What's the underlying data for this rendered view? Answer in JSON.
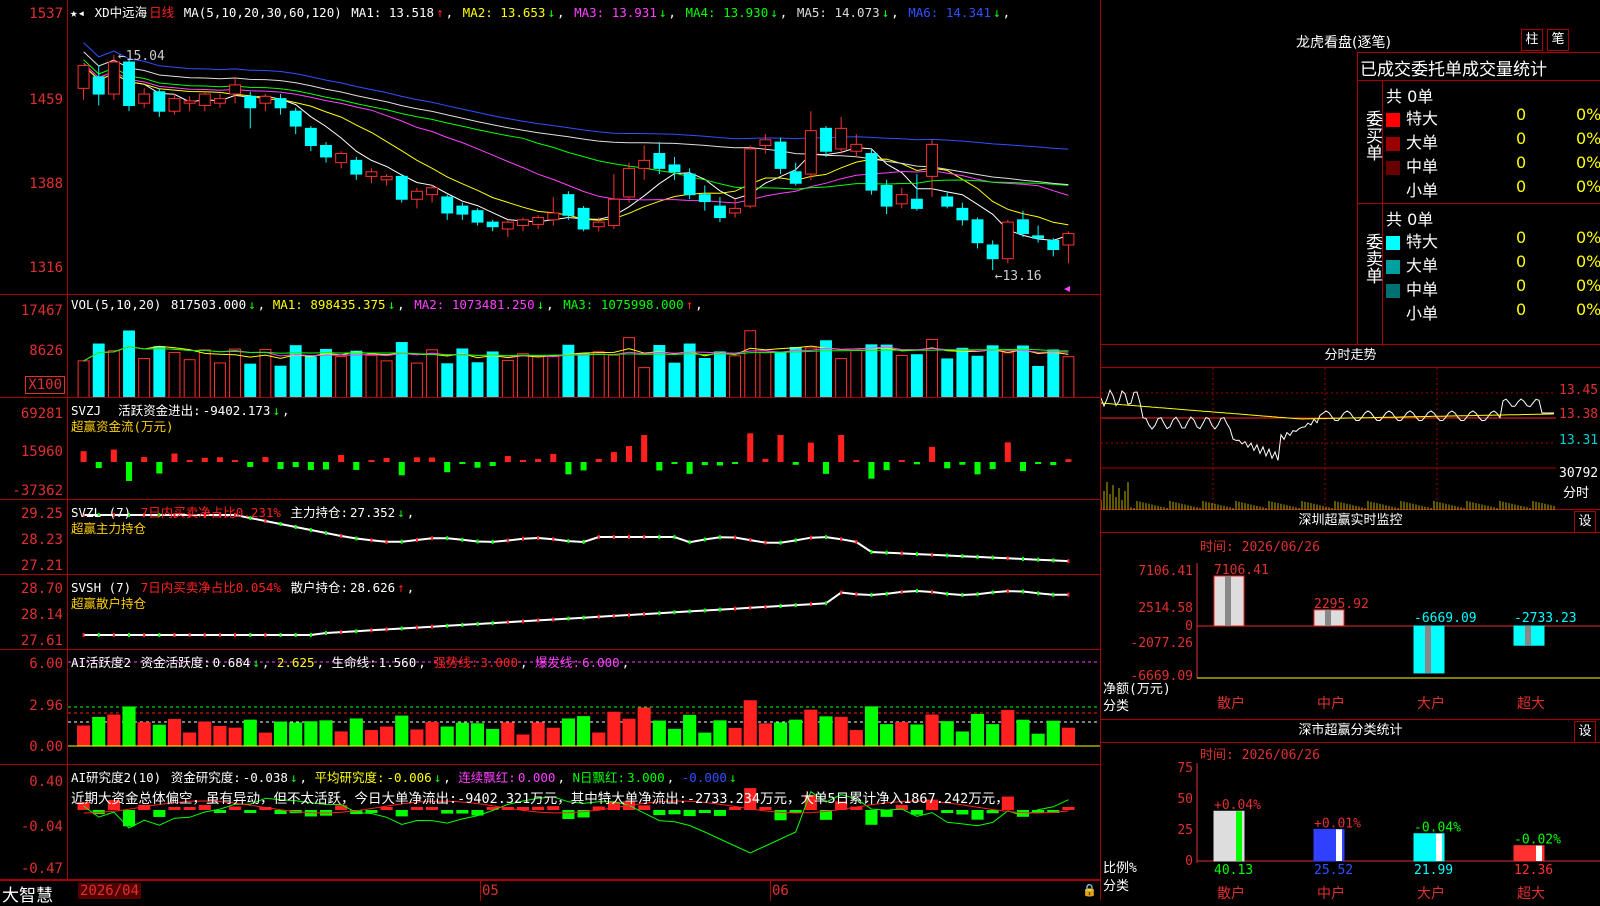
{
  "app": {
    "brand": "大智慧"
  },
  "kline": {
    "stock_name": "XD中远海",
    "period": "日线",
    "ma_params": "MA(5,10,20,30,60,120)",
    "ma_values": [
      {
        "label": "MA1:",
        "value": "13.518",
        "arrow": "↑",
        "color": "#ffffff"
      },
      {
        "label": "MA2:",
        "value": "13.653",
        "arrow": "↓",
        "color": "#ffff00"
      },
      {
        "label": "MA3:",
        "value": "13.931",
        "arrow": "↓",
        "color": "#ff40ff"
      },
      {
        "label": "MA4:",
        "value": "13.930",
        "arrow": "↓",
        "color": "#00ff00"
      },
      {
        "label": "MA5:",
        "value": "14.073",
        "arrow": "↓",
        "color": "#dddddd"
      },
      {
        "label": "MA6:",
        "value": "14.341",
        "arrow": "↓",
        "color": "#3050ff"
      }
    ],
    "y_ticks": [
      "1537",
      "1459",
      "1388",
      "1316"
    ],
    "high_label": "15.04",
    "low_label": "←13.16",
    "candles": [
      [
        14.75,
        14.95,
        14.65,
        14.85
      ],
      [
        14.85,
        14.7,
        14.6,
        14.95
      ],
      [
        14.7,
        14.98,
        14.65,
        15.04
      ],
      [
        14.98,
        14.6,
        14.55,
        15.0
      ],
      [
        14.62,
        14.7,
        14.58,
        14.75
      ],
      [
        14.72,
        14.55,
        14.5,
        14.75
      ],
      [
        14.55,
        14.66,
        14.52,
        14.7
      ],
      [
        14.62,
        14.64,
        14.55,
        14.68
      ],
      [
        14.6,
        14.7,
        14.55,
        14.72
      ],
      [
        14.62,
        14.66,
        14.58,
        14.7
      ],
      [
        14.7,
        14.78,
        14.62,
        14.85
      ],
      [
        14.68,
        14.58,
        14.4,
        14.72
      ],
      [
        14.62,
        14.68,
        14.55,
        14.7
      ],
      [
        14.66,
        14.58,
        14.52,
        14.7
      ],
      [
        14.55,
        14.42,
        14.35,
        14.58
      ],
      [
        14.4,
        14.25,
        14.2,
        14.42
      ],
      [
        14.25,
        14.15,
        14.1,
        14.28
      ],
      [
        14.1,
        14.18,
        14.05,
        14.2
      ],
      [
        14.12,
        14.0,
        13.95,
        14.15
      ],
      [
        13.98,
        14.02,
        13.92,
        14.05
      ],
      [
        13.95,
        13.98,
        13.9,
        14.0
      ],
      [
        13.98,
        13.78,
        13.75,
        14.0
      ],
      [
        13.78,
        13.85,
        13.7,
        13.88
      ],
      [
        13.82,
        13.88,
        13.75,
        13.9
      ],
      [
        13.8,
        13.66,
        13.6,
        13.82
      ],
      [
        13.72,
        13.65,
        13.6,
        13.75
      ],
      [
        13.68,
        13.58,
        13.55,
        13.7
      ],
      [
        13.58,
        13.54,
        13.5,
        13.6
      ],
      [
        13.52,
        13.58,
        13.45,
        13.6
      ],
      [
        13.55,
        13.6,
        13.5,
        13.62
      ],
      [
        13.56,
        13.62,
        13.52,
        13.64
      ],
      [
        13.6,
        13.66,
        13.55,
        13.8
      ],
      [
        13.82,
        13.64,
        13.6,
        13.85
      ],
      [
        13.7,
        13.52,
        13.5,
        13.72
      ],
      [
        13.54,
        13.58,
        13.5,
        13.62
      ],
      [
        13.55,
        13.78,
        13.52,
        14.0
      ],
      [
        13.8,
        14.05,
        13.75,
        14.1
      ],
      [
        14.05,
        14.12,
        13.95,
        14.25
      ],
      [
        14.18,
        14.05,
        14.0,
        14.28
      ],
      [
        14.08,
        14.02,
        13.95,
        14.15
      ],
      [
        14.0,
        13.82,
        13.78,
        14.05
      ],
      [
        13.82,
        13.76,
        13.68,
        13.9
      ],
      [
        13.72,
        13.62,
        13.58,
        13.8
      ],
      [
        13.66,
        13.7,
        13.62,
        13.78
      ],
      [
        13.72,
        14.22,
        13.7,
        14.25
      ],
      [
        14.25,
        14.3,
        14.18,
        14.35
      ],
      [
        14.28,
        14.05,
        14.0,
        14.32
      ],
      [
        14.02,
        13.92,
        13.9,
        14.1
      ],
      [
        14.0,
        14.38,
        13.95,
        14.55
      ],
      [
        14.4,
        14.2,
        14.15,
        14.42
      ],
      [
        14.22,
        14.4,
        14.18,
        14.5
      ],
      [
        14.2,
        14.26,
        14.15,
        14.35
      ],
      [
        14.18,
        13.86,
        13.82,
        14.22
      ],
      [
        13.9,
        13.72,
        13.65,
        13.95
      ],
      [
        13.74,
        13.82,
        13.7,
        13.88
      ],
      [
        13.78,
        13.7,
        13.68,
        14.0
      ],
      [
        13.98,
        14.26,
        13.8,
        14.3
      ],
      [
        13.8,
        13.72,
        13.7,
        13.85
      ],
      [
        13.7,
        13.6,
        13.55,
        13.75
      ],
      [
        13.6,
        13.4,
        13.35,
        13.62
      ],
      [
        13.38,
        13.26,
        13.16,
        13.42
      ],
      [
        13.26,
        13.58,
        13.22,
        13.6
      ],
      [
        13.6,
        13.48,
        13.45,
        13.68
      ],
      [
        13.46,
        13.44,
        13.4,
        13.55
      ],
      [
        13.42,
        13.34,
        13.28,
        13.44
      ],
      [
        13.38,
        13.48,
        13.22,
        13.5
      ]
    ]
  },
  "volume": {
    "title": "VOL(5,10,20)",
    "value": "817503.000",
    "arrow": "↓",
    "ma": [
      {
        "label": "MA1:",
        "value": "898435.375",
        "arrow": "↓",
        "color": "#ffff00"
      },
      {
        "label": "MA2:",
        "value": "1073481.250",
        "arrow": "↓",
        "color": "#ff40ff"
      },
      {
        "label": "MA3:",
        "value": "1075998.000",
        "arrow": "↑",
        "color": "#00ff00"
      }
    ],
    "y_ticks": [
      "17467",
      "8626"
    ],
    "unit_label": "X100"
  },
  "svzj": {
    "name": "SVZJ",
    "label": "活跃资金进出:",
    "value": "-9402.173",
    "arrow": "↓",
    "sub": "超赢资金流(万元)",
    "y_ticks": [
      "69281",
      "15960",
      "-37362"
    ]
  },
  "svzl": {
    "name": "SVZL (7)",
    "ratio": "7日内买卖净占比0.231%",
    "label": "主力持仓:",
    "value": "27.352",
    "arrow": "↓",
    "sub": "超赢主力持仓",
    "y_ticks": [
      "29.25",
      "28.23",
      "27.21"
    ]
  },
  "svsh": {
    "name": "SVSH (7)",
    "ratio": "7日内买卖净占比0.054%",
    "label": "散户持仓:",
    "value": "28.626",
    "arrow": "↑",
    "sub": "超赢散户持仓",
    "y_ticks": [
      "28.70",
      "28.14",
      "27.61"
    ]
  },
  "ai_active": {
    "name": "AI活跃度2",
    "label": "资金活跃度:",
    "value": "0.684",
    "arrow": "↓",
    "v2": "2.625",
    "life_label": "生命线:",
    "life": "1.560",
    "strong_label": "强势线:",
    "strong": "3.000",
    "burst_label": "爆发线:",
    "burst": "6.000",
    "y_ticks": [
      "6.00",
      "2.96",
      "0.00"
    ]
  },
  "ai_research": {
    "name": "AI研究度2(10)",
    "label": "资金研究度:",
    "value": "-0.038",
    "arrow": "↓",
    "avg_label": "平均研究度:",
    "avg": "-0.006",
    "avg_arrow": "↓",
    "red_label": "连续飘红:",
    "red": "0.000",
    "nred_label": "N日飘红:",
    "nred": "3.000",
    "nred2": "-0.000",
    "comment": "近期大资金总体偏空，虽有异动，但不太活跃，今日大单净流出:-9402.321万元，其中特大单净流出:-2733.234万元，大单5日累计净入1867.242万元，",
    "y_ticks": [
      "0.40",
      "-0.04",
      "-0.47"
    ]
  },
  "x_axis": {
    "labels": [
      "2026/04",
      "05",
      "06"
    ]
  },
  "dragon": {
    "title": "龙虎看盘(逐笔)",
    "btn1": "柱",
    "btn2": "笔",
    "header": "已成交委托单成交量统计",
    "buy_label": "委买单",
    "sell_label": "委卖单",
    "buy_total": "共 0单",
    "sell_total": "共 0单",
    "buy_rows": [
      {
        "name": "特大",
        "count": "0",
        "pct": "0%",
        "color": "#ff0000"
      },
      {
        "name": "大单",
        "count": "0",
        "pct": "0%",
        "color": "#990000"
      },
      {
        "name": "中单",
        "count": "0",
        "pct": "0%",
        "color": "#660000"
      },
      {
        "name": "小单",
        "count": "0",
        "pct": "0%",
        "color": "#000000"
      }
    ],
    "sell_rows": [
      {
        "name": "特大",
        "count": "0",
        "pct": "0%",
        "color": "#00ffff"
      },
      {
        "name": "大单",
        "count": "0",
        "pct": "0%",
        "color": "#00a0a0"
      },
      {
        "name": "中单",
        "count": "0",
        "pct": "0%",
        "color": "#007070"
      },
      {
        "name": "小单",
        "count": "0",
        "pct": "0%",
        "color": "#000000"
      }
    ]
  },
  "intraday": {
    "title": "分时走势",
    "prices": [
      "13.45",
      "13.38",
      "13.31"
    ],
    "vol": "30792",
    "tag": "分时"
  },
  "monitor": {
    "title": "深圳超赢实时监控",
    "btn": "设",
    "time_label": "时间:",
    "time": "2026/06/26",
    "y_ticks": [
      "7106.41",
      "2514.58",
      "0",
      "-2077.26",
      "-6669.09"
    ],
    "net_label": "净额(万元)",
    "cat_label": "分类",
    "bars": [
      {
        "name": "散户",
        "value": 7106.41,
        "text": "7106.41"
      },
      {
        "name": "中户",
        "value": 2295.92,
        "text": "2295.92"
      },
      {
        "name": "大户",
        "value": -6669.09,
        "text": "-6669.09"
      },
      {
        "name": "超大",
        "value": -2733.23,
        "text": "-2733.23"
      }
    ]
  },
  "classify": {
    "title": "深市超赢分类统计",
    "btn": "设",
    "time_label": "时间:",
    "time": "2026/06/26",
    "y_ticks": [
      "75",
      "50",
      "25",
      "0"
    ],
    "ratio_label": "比例%",
    "cat_label": "分类",
    "bars": [
      {
        "name": "散户",
        "value": 40.13,
        "text": "40.13",
        "change": "+0.04%"
      },
      {
        "name": "中户",
        "value": 25.52,
        "text": "25.52",
        "change": "+0.01%"
      },
      {
        "name": "大户",
        "value": 21.99,
        "text": "21.99",
        "change": "-0.04%"
      },
      {
        "name": "超大",
        "value": 12.36,
        "text": "12.36",
        "change": "-0.02%"
      }
    ]
  }
}
